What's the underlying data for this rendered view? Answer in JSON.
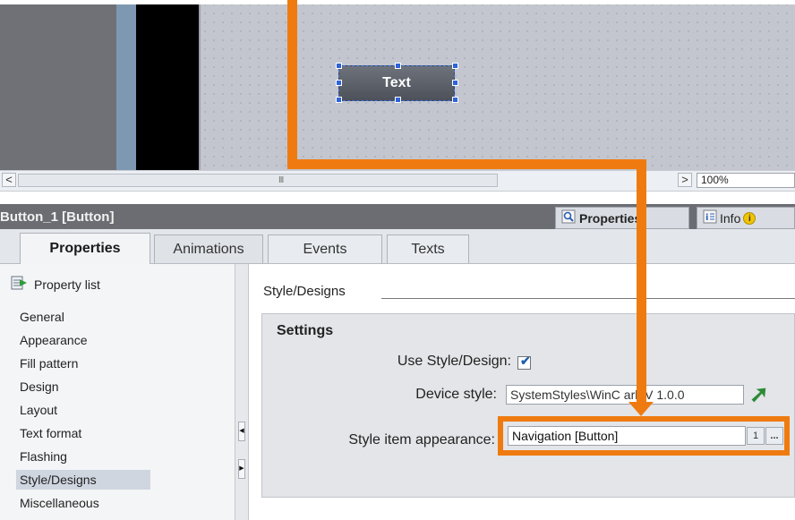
{
  "canvas": {
    "button_text": "Text"
  },
  "scroll": {
    "left_arrow": "<",
    "right_arrow": ">",
    "thumb_grip": "III",
    "zoom": "100%"
  },
  "inspector": {
    "title": "Button_1 [Button]",
    "top_tabs": {
      "properties": "Properties",
      "info": "Info"
    }
  },
  "tabs": [
    "Properties",
    "Animations",
    "Events",
    "Texts"
  ],
  "sidebar": {
    "header": "Property list",
    "items": [
      "General",
      "Appearance",
      "Fill pattern",
      "Design",
      "Layout",
      "Text format",
      "Flashing",
      "Style/Designs",
      "Miscellaneous"
    ],
    "selected": "Style/Designs"
  },
  "main": {
    "section_heading": "Style/Designs",
    "settings_title": "Settings",
    "use_style_label": "Use Style/Design:",
    "use_style_checked": true,
    "device_style_label": "Device style:",
    "device_style_value": "SystemStyles\\WinC    ark V 1.0.0",
    "style_item_label": "Style item appearance:",
    "style_item_value": "Navigation [Button]",
    "style_item_btn": "...",
    "style_item_small": "1"
  },
  "colors": {
    "highlight": "#ef7b10",
    "inspector_title": "#6b6d72",
    "checkbox_accent": "#1f5fb0"
  }
}
